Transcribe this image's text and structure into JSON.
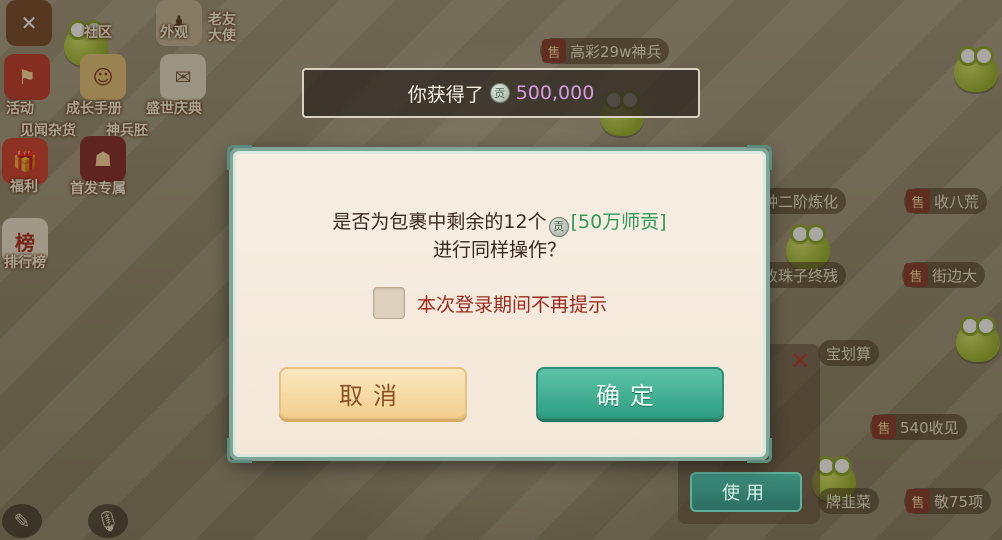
{
  "toast": {
    "text": "你获得了",
    "coin_glyph": "贡",
    "amount": "500,000",
    "amount_color": "#d59ae0"
  },
  "dialog": {
    "line1_prefix": "是否为包裹中剩余的12个",
    "coin_glyph": "贡",
    "item_name": "[50万师贡]",
    "item_color": "#2f9a5a",
    "line2": "进行同样操作？",
    "checkbox_label": "本次登录期间不再提示",
    "checkbox_checked": false,
    "cancel_label": "取消",
    "confirm_label": "确定"
  },
  "use_panel": {
    "close_glyph": "✕",
    "use_label": "使用"
  },
  "stalls": [
    {
      "tag": "售",
      "text": "高彩29w神兵"
    },
    {
      "tag": "售",
      "text": "收八荒"
    },
    {
      "tag": "售",
      "text": "街边大"
    },
    {
      "tag": "售",
      "text": "540收见"
    },
    {
      "tag": "售",
      "text": "敬75项"
    },
    {
      "tag": "",
      "text": "各种二阶炼化"
    },
    {
      "tag": "",
      "text": "价收珠子终残"
    },
    {
      "tag": "",
      "text": "宝划算"
    },
    {
      "tag": "",
      "text": "牌韭菜"
    }
  ],
  "sidebar": {
    "items": [
      {
        "label": "社区"
      },
      {
        "label": "外观"
      },
      {
        "label": "老友大使"
      },
      {
        "label": "活动"
      },
      {
        "label": "成长手册"
      },
      {
        "label": "盛世庆典"
      },
      {
        "label": "见闻杂货"
      },
      {
        "label": "神兵胚"
      },
      {
        "label": "福利"
      },
      {
        "label": "首发专属"
      },
      {
        "label": "排行榜"
      }
    ]
  }
}
